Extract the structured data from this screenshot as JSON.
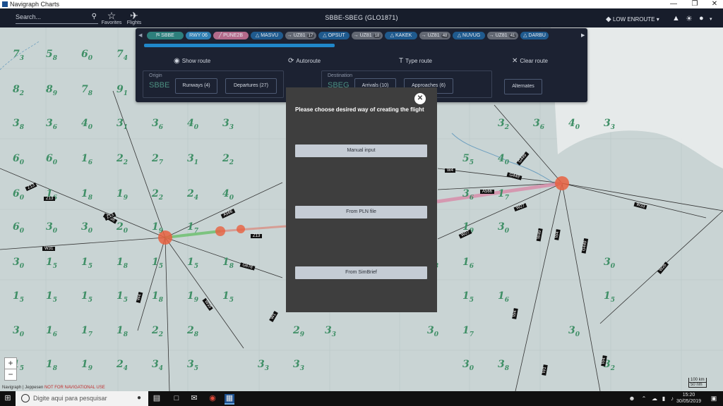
{
  "window": {
    "title": "Navigraph Charts",
    "controls": [
      "—",
      "❐",
      "✕"
    ]
  },
  "header": {
    "search_placeholder": "Search...",
    "favorites_label": "Favorites",
    "flights_label": "Flights",
    "flight_title": "SBBE-SBEG (GLO1871)",
    "chart_mode": "LOW ENROUTE"
  },
  "route": {
    "waypoints": [
      {
        "label": "SBBE",
        "kind": "origin",
        "prefix": "⛿"
      },
      {
        "label": "RWY 06",
        "kind": "rwy",
        "prefix": ""
      },
      {
        "label": "PUNE2B",
        "kind": "proc",
        "prefix": "╱"
      },
      {
        "label": "MASVU",
        "kind": "fix",
        "prefix": "△"
      },
      {
        "label": "UZ81",
        "kind": "airway",
        "prefix": "→",
        "count": "17"
      },
      {
        "label": "OPSUT",
        "kind": "fix",
        "prefix": "△"
      },
      {
        "label": "UZ81",
        "kind": "airway",
        "prefix": "→",
        "count": "18"
      },
      {
        "label": "KAKEK",
        "kind": "fix",
        "prefix": "△"
      },
      {
        "label": "UZ81",
        "kind": "airway",
        "prefix": "→",
        "count": "48"
      },
      {
        "label": "NUVUG",
        "kind": "fix",
        "prefix": "△"
      },
      {
        "label": "UZ81",
        "kind": "airway",
        "prefix": "→",
        "count": "41"
      },
      {
        "label": "DARBU",
        "kind": "fix",
        "prefix": "△"
      }
    ],
    "actions": {
      "show_route": "Show route",
      "autoroute": "Autoroute",
      "type_route": "Type route",
      "clear_route": "Clear route"
    },
    "origin": {
      "label": "Origin",
      "value": "SBBE",
      "runways": "Runways (4)",
      "departures": "Departures (27)"
    },
    "destination": {
      "label": "Destination",
      "value": "SBEG",
      "arrivals": "Arrivals (10)",
      "approaches": "Approaches (6)"
    },
    "alternates": "Alternates"
  },
  "modal": {
    "title": "Please choose desired way of creating the flight",
    "options": [
      "Manual input",
      "From PLN file",
      "From SimBrief"
    ]
  },
  "map": {
    "airway_labels": [
      "Z13",
      "Z13",
      "A566",
      "W31",
      "A566",
      "Z13",
      "G678",
      "W35",
      "W1",
      "W4",
      "W4",
      "G449",
      "G449",
      "A566",
      "W27",
      "W27",
      "W33",
      "W26",
      "W4",
      "W49",
      "W4",
      "W1",
      "G449",
      "W4",
      "Z13"
    ],
    "zoom_in": "+",
    "zoom_out": "−",
    "attribution_brand": "Navigraph",
    "attribution_partner": "Jeppesen",
    "attribution_warning": "NOT FOR NAVIGATIONAL USE",
    "scale_km": "100 km",
    "scale_nm": "50 nm"
  },
  "taskbar": {
    "search_placeholder": "Digite aqui para pesquisar",
    "time": "15:20",
    "date": "30/05/2019"
  }
}
